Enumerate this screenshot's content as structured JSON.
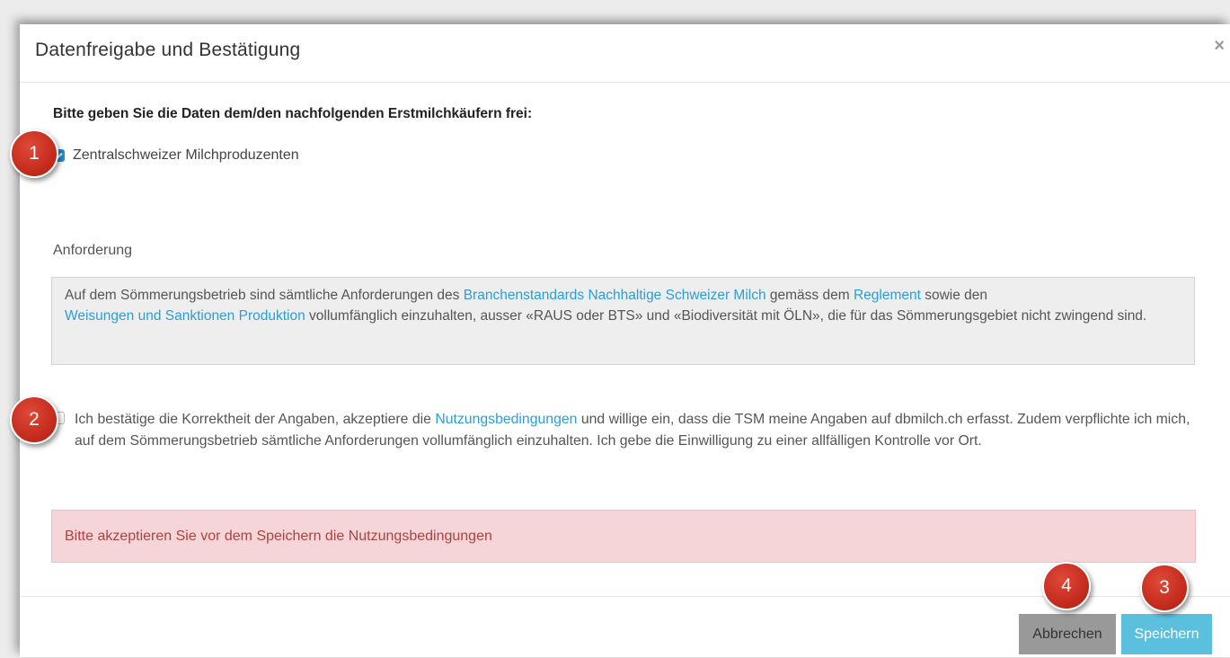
{
  "modal": {
    "title": "Datenfreigabe und Bestätigung",
    "close_symbol": "×",
    "instruction": "Bitte geben Sie die Daten dem/den nachfolgenden Erstmilchkäufern frei:",
    "buyers": [
      {
        "label": "Zentralschweizer Milchproduzenten",
        "checked": true
      }
    ],
    "requirement_label": "Anforderung",
    "requirement": {
      "text_1": "Auf dem Sömmerungsbetrieb sind sämtliche Anforderungen des ",
      "link_1": "Branchenstandards Nachhaltige Schweizer Milch",
      "text_2": " gemäss dem ",
      "link_2": "Reglement",
      "text_3": " sowie den ",
      "link_3": "Weisungen und Sanktionen Produktion",
      "text_4": " vollumfänglich einzuhalten, ausser «RAUS oder BTS» und «Biodiversität mit ÖLN», die für das Sömmerungsgebiet nicht zwingend sind."
    },
    "confirmation": {
      "checked": false,
      "text_1": "Ich bestätige die Korrektheit der Angaben, akzeptiere die ",
      "link": "Nutzungsbedingungen",
      "text_2": " und willige ein, dass die TSM meine Angaben auf dbmilch.ch erfasst. Zudem verpflichte ich mich, auf dem Sömmerungsbetrieb sämtliche Anforderungen vollumfänglich einzuhalten. Ich gebe die Einwilligung zu einer allfälligen Kontrolle vor Ort."
    },
    "alert": "Bitte akzeptieren Sie vor dem Speichern die Nutzungsbedingungen",
    "buttons": {
      "cancel": "Abbrechen",
      "save": "Speichern"
    }
  },
  "annotations": [
    "1",
    "2",
    "3",
    "4"
  ],
  "colors": {
    "link": "#2a9fd6",
    "checkbox_checked": "#1f8fd4",
    "alert_bg": "#f5d5d8",
    "alert_text": "#a94442",
    "save_button": "#5bc0de",
    "cancel_button": "#999999",
    "marker": "#c0281a"
  }
}
